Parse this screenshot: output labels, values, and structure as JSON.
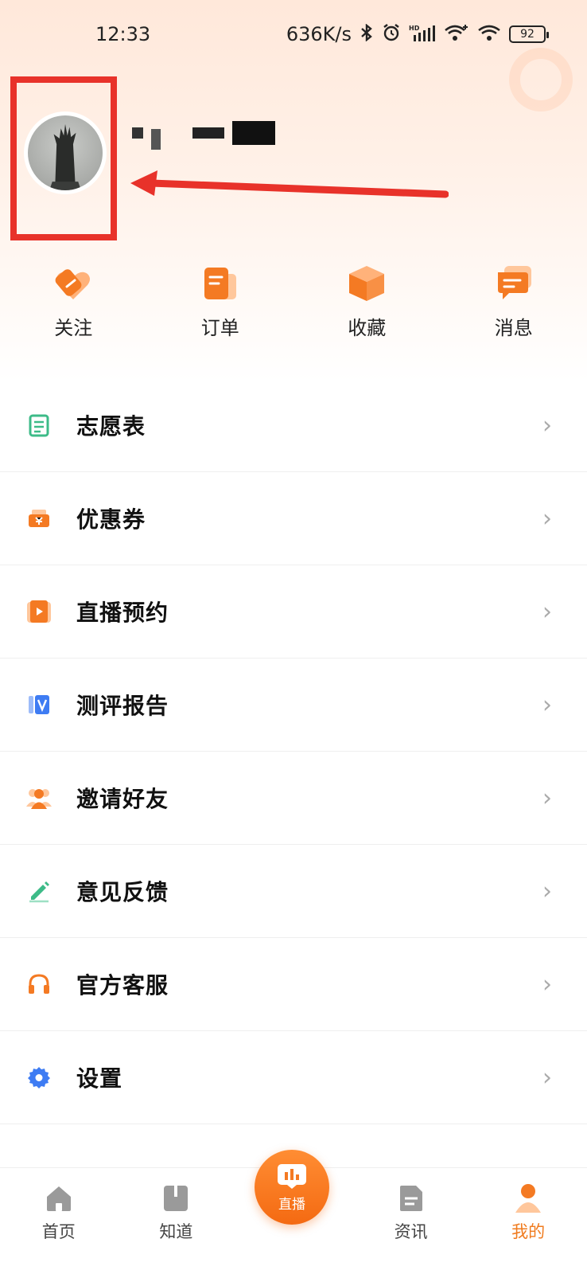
{
  "status_bar": {
    "time": "12:33",
    "net_speed": "636K/s",
    "battery": "92",
    "icons": [
      "bluetooth-icon",
      "alarm-icon",
      "hd-signal-icon",
      "wifi-plus-icon",
      "wifi-icon",
      "battery-icon"
    ]
  },
  "profile": {
    "avatar_icon": "avatar-image",
    "username_redacted": true
  },
  "quick_actions": [
    {
      "label": "关注",
      "icon": "follow-heart-icon"
    },
    {
      "label": "订单",
      "icon": "order-doc-icon"
    },
    {
      "label": "收藏",
      "icon": "favorite-box-icon"
    },
    {
      "label": "消息",
      "icon": "message-bubble-icon"
    }
  ],
  "menu": [
    {
      "label": "志愿表",
      "icon": "application-form-icon",
      "color": "#3dbb88"
    },
    {
      "label": "优惠券",
      "icon": "coupon-icon",
      "color": "#f07b1e"
    },
    {
      "label": "直播预约",
      "icon": "live-booking-icon",
      "color": "#f07b1e"
    },
    {
      "label": "测评报告",
      "icon": "report-icon",
      "color": "#3e7cf3"
    },
    {
      "label": "邀请好友",
      "icon": "invite-friend-icon",
      "color": "#f07b1e"
    },
    {
      "label": "意见反馈",
      "icon": "feedback-pen-icon",
      "color": "#3dbb88"
    },
    {
      "label": "官方客服",
      "icon": "headset-icon",
      "color": "#f07b1e"
    },
    {
      "label": "设置",
      "icon": "settings-gear-icon",
      "color": "#3e7cf3"
    }
  ],
  "bottom_nav": {
    "items": [
      {
        "label": "首页",
        "icon": "home-icon"
      },
      {
        "label": "知道",
        "icon": "book-icon"
      },
      {
        "label": "直播",
        "icon": "live-icon"
      },
      {
        "label": "资讯",
        "icon": "news-doc-icon"
      },
      {
        "label": "我的",
        "icon": "profile-icon",
        "active": true
      }
    ]
  },
  "colors": {
    "accent": "#f07b1e",
    "highlight_box": "#e8322a"
  }
}
